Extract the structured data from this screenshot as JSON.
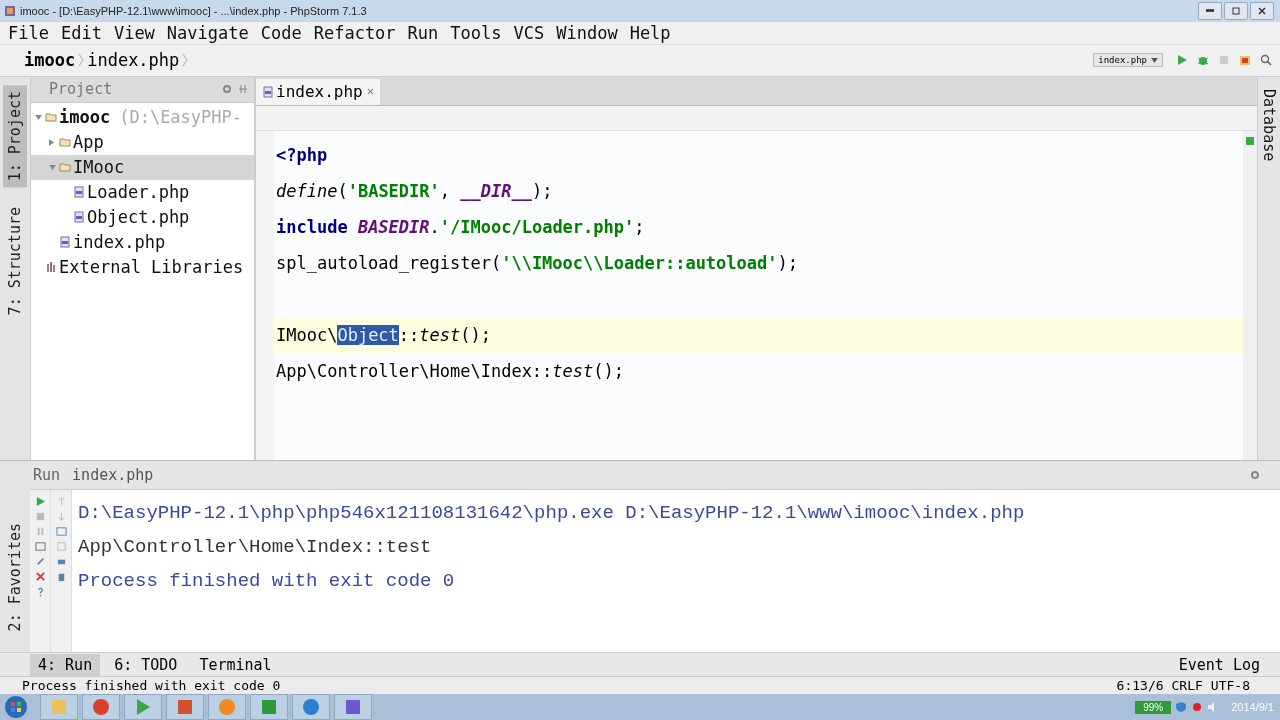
{
  "window": {
    "title": "imooc - [D:\\EasyPHP-12.1\\www\\imooc] - ...\\index.php - PhpStorm 7.1.3"
  },
  "menu": [
    "File",
    "Edit",
    "View",
    "Navigate",
    "Code",
    "Refactor",
    "Run",
    "Tools",
    "VCS",
    "Window",
    "Help"
  ],
  "breadcrumbs": [
    "imooc",
    "index.php"
  ],
  "run_config": "index.php",
  "left_tool_tabs": [
    {
      "label": "1: Project",
      "selected": true
    },
    {
      "label": "7: Structure",
      "selected": false
    }
  ],
  "project_panel": {
    "title": "Project",
    "tree": [
      {
        "label": "imooc",
        "path": "(D:\\EasyPHP-",
        "kind": "folder",
        "expanded": true,
        "selected": false,
        "children": [
          {
            "label": "App",
            "kind": "folder",
            "expanded": false,
            "selected": false
          },
          {
            "label": "IMooc",
            "kind": "folder",
            "expanded": true,
            "selected": true,
            "children": [
              {
                "label": "Loader.php",
                "kind": "file",
                "selected": false
              },
              {
                "label": "Object.php",
                "kind": "file",
                "selected": false
              }
            ]
          },
          {
            "label": "index.php",
            "kind": "file",
            "selected": false
          }
        ]
      },
      {
        "label": "External Libraries",
        "kind": "library",
        "selected": false
      }
    ]
  },
  "editor": {
    "tabs": [
      {
        "label": "index.php",
        "selected": true
      }
    ],
    "lines": [
      {
        "current": false,
        "tokens": [
          {
            "kind": "keyword",
            "text": "<?php"
          }
        ]
      },
      {
        "current": false,
        "tokens": [
          {
            "kind": "call",
            "text": "define"
          },
          {
            "kind": "plain",
            "text": "("
          },
          {
            "kind": "string",
            "text": "'BASEDIR'"
          },
          {
            "kind": "plain",
            "text": ", "
          },
          {
            "kind": "constant",
            "text": "__DIR__"
          },
          {
            "kind": "plain",
            "text": ");"
          }
        ]
      },
      {
        "current": false,
        "tokens": [
          {
            "kind": "keyword",
            "text": "include "
          },
          {
            "kind": "constant",
            "text": "BASEDIR"
          },
          {
            "kind": "plain",
            "text": "."
          },
          {
            "kind": "string",
            "text": "'/IMooc/Loader.php'"
          },
          {
            "kind": "plain",
            "text": ";"
          }
        ]
      },
      {
        "current": false,
        "tokens": [
          {
            "kind": "plain",
            "text": "spl_autoload_register("
          },
          {
            "kind": "string",
            "text": "'\\\\IMooc\\\\Loader::autoload'"
          },
          {
            "kind": "plain",
            "text": ");"
          }
        ]
      },
      {
        "current": false
      },
      {
        "current": true,
        "tokens": [
          {
            "kind": "plain",
            "text": "IMooc\\"
          },
          {
            "kind": "selection",
            "text": "Object"
          },
          {
            "kind": "plain",
            "text": "::"
          },
          {
            "kind": "call",
            "text": "test"
          },
          {
            "kind": "plain",
            "text": "();"
          }
        ]
      },
      {
        "current": false,
        "tokens": [
          {
            "kind": "plain",
            "text": "App\\Controller\\Home\\Index::"
          },
          {
            "kind": "call",
            "text": "test"
          },
          {
            "kind": "plain",
            "text": "();"
          }
        ]
      }
    ]
  },
  "right_tool_tabs": [
    "Database"
  ],
  "run_panel": {
    "title": "Run",
    "tab": "index.php",
    "output": [
      {
        "kind": "command",
        "text": "D:\\EasyPHP-12.1\\php\\php546x121108131642\\php.exe D:\\EasyPHP-12.1\\www\\imooc\\index.php"
      },
      {
        "kind": "output",
        "text": "App\\Controller\\Home\\Index::test"
      },
      {
        "kind": "command",
        "text": "Process finished with exit code 0"
      }
    ]
  },
  "favorites_tab": "2: Favorites",
  "bottom_tabs": [
    {
      "label": "4: Run",
      "selected": true
    },
    {
      "label": "6: TODO",
      "selected": false
    },
    {
      "label": "Terminal",
      "selected": false
    }
  ],
  "event_log": "Event Log",
  "status_bar": {
    "message": "Process finished with exit code 0",
    "position": "6:13/6",
    "line_separator": "CRLF",
    "encoding": "UTF-8"
  },
  "taskbar": {
    "battery": "99%",
    "date": "2014/9/1"
  }
}
